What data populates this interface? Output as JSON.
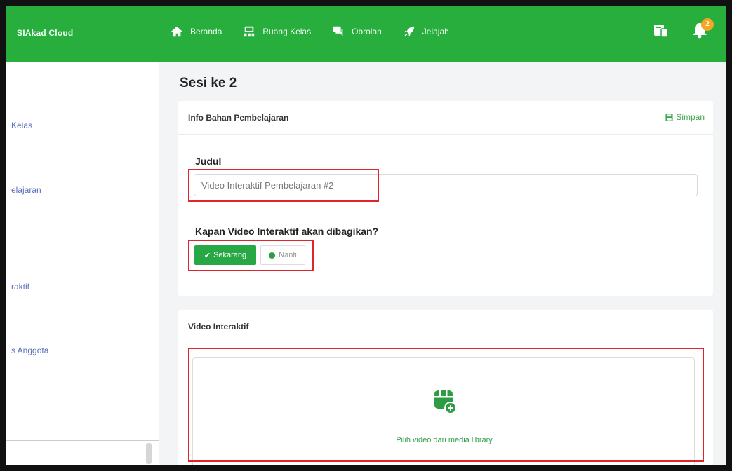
{
  "app": {
    "brand": "SIAkad Cloud"
  },
  "nav": {
    "items": [
      {
        "label": "Beranda",
        "icon": "home-icon"
      },
      {
        "label": "Ruang Kelas",
        "icon": "classroom-icon"
      },
      {
        "label": "Obrolan",
        "icon": "chat-icon"
      },
      {
        "label": "Jelajah",
        "icon": "rocket-icon"
      }
    ],
    "notification_count": "2"
  },
  "sidebar": {
    "items": [
      {
        "label": "Kelas"
      },
      {
        "label": "elajaran"
      },
      {
        "label": "raktif"
      },
      {
        "label": "s Anggota"
      }
    ]
  },
  "page": {
    "title": "Sesi ke 2"
  },
  "info_card": {
    "title": "Info Bahan Pembelajaran",
    "save_label": "Simpan",
    "judul_label": "Judul",
    "judul_value": "Video Interaktif Pembelajaran #2",
    "share_question": "Kapan Video Interaktif akan dibagikan?",
    "btn_now": "Sekarang",
    "btn_later": "Nanti"
  },
  "video_card": {
    "title": "Video Interaktif",
    "dropzone_text": "Pilih video dari media library"
  },
  "colors": {
    "brand_green": "#27ae3d",
    "button_green": "#28a745",
    "highlight_red": "#e0252c",
    "badge_orange": "#f5a623",
    "sidebar_link": "#5a6fb8"
  }
}
